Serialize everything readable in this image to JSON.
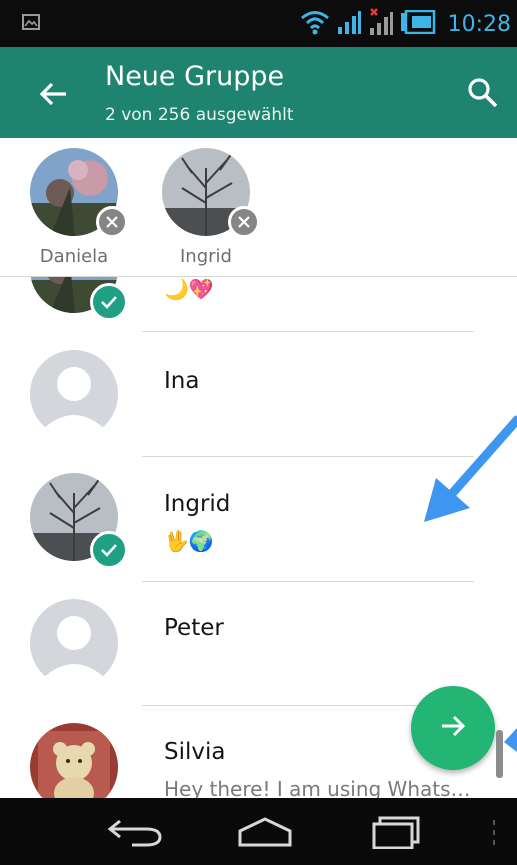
{
  "status_bar": {
    "time": "10:28",
    "icons": [
      "image-notification-icon",
      "wifi-icon",
      "signal-icon",
      "signal-no-service-icon",
      "battery-icon"
    ],
    "accent_color": "#3fb4e6"
  },
  "app_bar": {
    "title": "Neue Gruppe",
    "subtitle": "2 von 256 ausgewählt",
    "color": "#1e8470"
  },
  "selected": [
    {
      "name": "Daniela"
    },
    {
      "name": "Ingrid"
    }
  ],
  "contacts": [
    {
      "name": "",
      "status": "🌙💖",
      "selected": true,
      "avatar": "photo-pink-flowers"
    },
    {
      "name": "Ina",
      "status": "",
      "selected": false,
      "avatar": "default"
    },
    {
      "name": "Ingrid",
      "status": "🖖🌍",
      "selected": true,
      "avatar": "photo-winter-trees"
    },
    {
      "name": "Peter",
      "status": "",
      "selected": false,
      "avatar": "default"
    },
    {
      "name": "Silvia",
      "status": "Hey there! I am using Whats…",
      "selected": false,
      "avatar": "photo-teddy-bear"
    }
  ],
  "fab": {
    "icon": "arrow-right-icon",
    "color": "#22b574"
  },
  "nav_bar": {
    "icons": [
      "back-nav-icon",
      "home-nav-icon",
      "recents-nav-icon",
      "overflow-menu-icon"
    ]
  }
}
